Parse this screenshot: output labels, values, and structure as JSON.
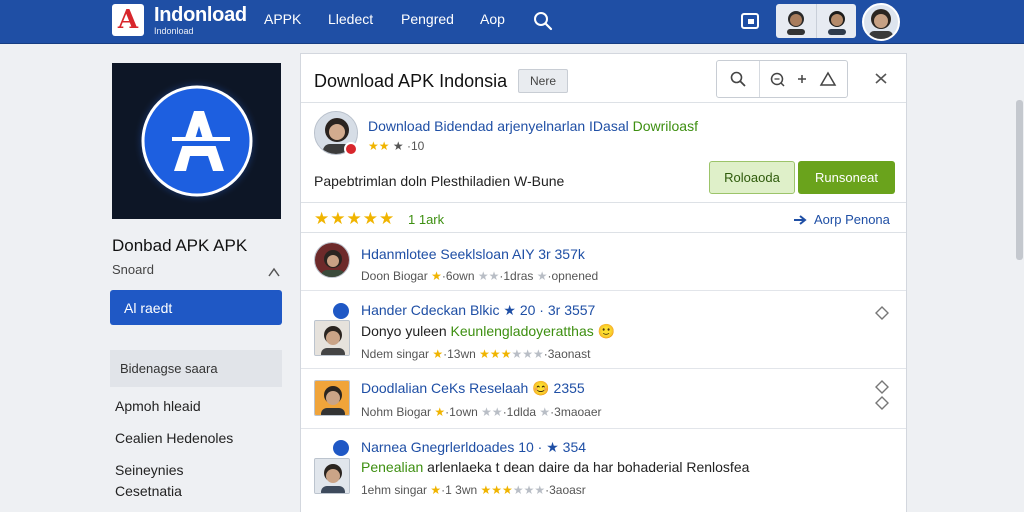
{
  "header": {
    "logo_letter": "A",
    "logo_title": "Indonload",
    "logo_subtitle": "Indonload",
    "nav": [
      "APPK",
      "Lledect",
      "Pengred",
      "Aop"
    ]
  },
  "sidebar": {
    "app_name": "Donbad APK APK",
    "developer": "Snoard",
    "install_label": "Al raedt",
    "section_label": "Bidenagse saara",
    "links": [
      "Apmoh hleaid",
      "Cealien Hedenoles",
      "Seineynies",
      "Cesetnatia"
    ]
  },
  "panel": {
    "title": "Download APK Indonsia",
    "more_label": "Nere",
    "feature": {
      "title_main": "Download Bidendad arjenyelnarlan IDasal",
      "title_highlight": "Dowriloasf",
      "rating_stars": "★★",
      "rating_text": "★ ·10",
      "description": "Papebtrimlan doln Plesthiladien W-Bune",
      "btn_secondary": "Roloaoda",
      "btn_primary": "Runsoneat"
    },
    "summary": {
      "stars": "★★★★★",
      "count": "1 1ark",
      "link": "Aorp Penona"
    },
    "reviews": [
      {
        "name": "Hdanmlotee Seeklsloan AIY 3r 357k",
        "text": "",
        "text_highlight": "",
        "meta_prefix": "Doon Biogar",
        "meta_mid": "·6own",
        "meta_mid2": "·1dras",
        "meta_suffix": "·opnened",
        "stars_on": 1,
        "stars_on2": 0
      },
      {
        "name": "Hander Cdeckan Blkic ★ 20 · 3r 3557",
        "text": "Donyo yuleen ",
        "text_highlight": "Keunlengladoyeratthas",
        "meta_prefix": "Ndem singar",
        "meta_mid": "·13wn",
        "meta_mid2": "",
        "meta_suffix": "·3aonast",
        "stars_on": 1,
        "stars_on2": 3
      },
      {
        "name": "Doodlalian CeKs Reselaah 😊 2355",
        "text": "",
        "text_highlight": "",
        "meta_prefix": "Nohm Biogar",
        "meta_mid": "·1own",
        "meta_mid2": "·1dlda",
        "meta_suffix": "·3maoaer",
        "stars_on": 1,
        "stars_on2": 0
      },
      {
        "name": "Narnea Gnegrlerldoades 10 · ★ 354",
        "text": "arlenlaeka t dean daire da har bohaderial Renlosfea",
        "text_highlight": "Penealian",
        "meta_prefix": "1ehm singar",
        "meta_mid": "·1 3wn",
        "meta_mid2": "",
        "meta_suffix": "·3aoasr",
        "stars_on": 1,
        "stars_on2": 3
      }
    ]
  },
  "colors": {
    "brand": "#1f4fa5",
    "accent_green": "#6aa31c",
    "star": "#f0b400",
    "logo_red": "#d8262c"
  },
  "icons": [
    "search-icon",
    "share-icon",
    "zoom-icon",
    "plus-icon",
    "close-icon",
    "flag-icon",
    "arrow-icon",
    "window-icon"
  ]
}
